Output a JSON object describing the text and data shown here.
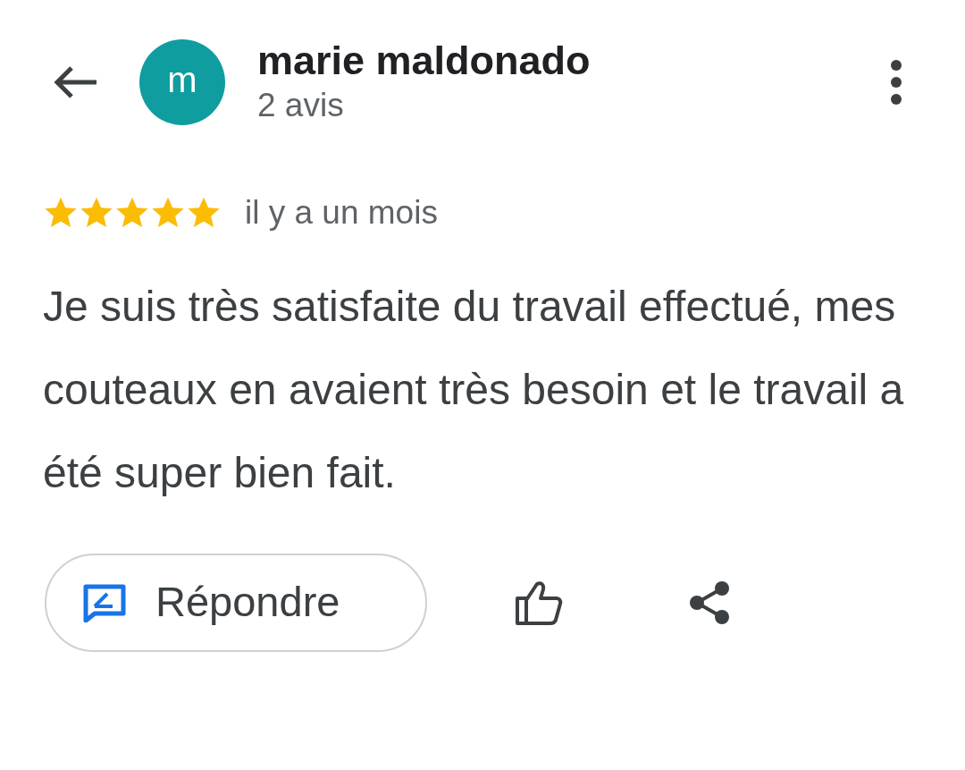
{
  "reviewer": {
    "initial": "m",
    "name": "marie maldonado",
    "review_count": "2 avis"
  },
  "review": {
    "stars": 5,
    "time": "il y a un mois",
    "text": "Je suis très satisfaite du travail effectué, mes couteaux en avaient très besoin et le travail a été super bien fait."
  },
  "actions": {
    "reply": "Répondre"
  }
}
